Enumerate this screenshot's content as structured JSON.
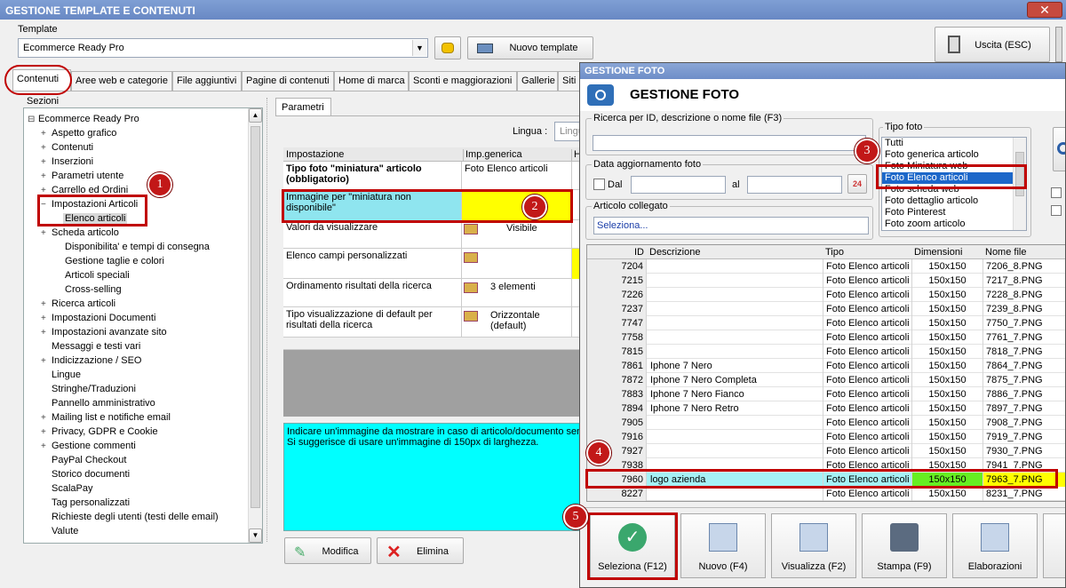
{
  "main_title": "GESTIONE TEMPLATE E CONTENUTI",
  "close_label": "✕",
  "template": {
    "label": "Template",
    "value": "Ecommerce Ready Pro",
    "new_label": "Nuovo template",
    "exit_label": "Uscita (ESC)"
  },
  "tabs": [
    "Contenuti",
    "Aree web e categorie",
    "File aggiuntivi",
    "Pagine di contenuti",
    "Home di marca",
    "Sconti e maggiorazioni",
    "Gallerie",
    "Siti"
  ],
  "sections_label": "Sezioni",
  "tree": [
    {
      "t": "Ecommerce Ready Pro",
      "pm": "⊟"
    },
    {
      "t": "Aspetto grafico",
      "pm": "+"
    },
    {
      "t": "Contenuti",
      "pm": "+"
    },
    {
      "t": "Inserzioni",
      "pm": "+"
    },
    {
      "t": "Parametri utente",
      "pm": "+"
    },
    {
      "t": "Carrello ed Ordini",
      "pm": "+"
    },
    {
      "t": "Impostazioni Articoli",
      "pm": "−"
    },
    {
      "t": "Elenco articoli",
      "pm": ""
    },
    {
      "t": "Scheda articolo",
      "pm": "+"
    },
    {
      "t": "Disponibilita' e tempi di consegna",
      "pm": ""
    },
    {
      "t": "Gestione taglie e colori",
      "pm": ""
    },
    {
      "t": "Articoli speciali",
      "pm": ""
    },
    {
      "t": "Cross-selling",
      "pm": ""
    },
    {
      "t": "Ricerca articoli",
      "pm": "+"
    },
    {
      "t": "Impostazioni Documenti",
      "pm": "+"
    },
    {
      "t": "Impostazioni avanzate sito",
      "pm": "+"
    },
    {
      "t": "Messaggi e testi vari",
      "pm": ""
    },
    {
      "t": "Indicizzazione / SEO",
      "pm": "+"
    },
    {
      "t": "Lingue",
      "pm": ""
    },
    {
      "t": "Stringhe/Traduzioni",
      "pm": ""
    },
    {
      "t": "Pannello amministrativo",
      "pm": ""
    },
    {
      "t": "Mailing list e notifiche email",
      "pm": "+"
    },
    {
      "t": "Privacy, GDPR e Cookie",
      "pm": "+"
    },
    {
      "t": "Gestione commenti",
      "pm": "+"
    },
    {
      "t": "PayPal Checkout",
      "pm": ""
    },
    {
      "t": "Storico documenti",
      "pm": ""
    },
    {
      "t": "ScalaPay",
      "pm": ""
    },
    {
      "t": "Tag personalizzati",
      "pm": ""
    },
    {
      "t": "Richieste degli utenti (testi delle email)",
      "pm": ""
    },
    {
      "t": "Valute",
      "pm": ""
    }
  ],
  "params": {
    "tab": "Parametri",
    "lingua_label": "Lingua :",
    "lingua_value": "Lingu",
    "col_setting": "Impostazione",
    "col_generic": "Imp.generica",
    "col_h": "H",
    "rows": [
      {
        "s": "Tipo foto \"miniatura\" articolo (obbligatorio)",
        "v": ""
      },
      {
        "s": "Immagine per \"miniatura non disponibile\"",
        "v": ""
      },
      {
        "s": "Valori da visualizzare",
        "v": "Visibile"
      },
      {
        "s": "Elenco campi personalizzati",
        "v": ""
      },
      {
        "s": "Ordinamento risultati della ricerca",
        "v": "3 elementi"
      },
      {
        "s": "Tipo visualizzazione di default per risultati della ricerca",
        "v": "Orizzontale (default)"
      }
    ],
    "row0_value": "Foto Elenco articoli",
    "description": "Indicare un'immagine da mostrare in caso di articolo/documento senza\nSi suggerisce di usare un'immagine di 150px di larghezza.",
    "modify": "Modifica",
    "delete": "Elimina"
  },
  "foto": {
    "title": "GESTIONE FOTO",
    "header": "GESTIONE FOTO",
    "search_label": "Ricerca per ID, descrizione o nome file (F3)",
    "date_label": "Data aggiornamento foto",
    "dal": "Dal",
    "al": "al",
    "articolo_label": "Articolo collegato",
    "articolo_value": "Seleziona...",
    "tipo_label": "Tipo foto",
    "tipi": [
      "Tutti",
      "Foto generica articolo",
      "Foto Miniatura web",
      "Foto Elenco articoli",
      "Foto scheda web",
      "Foto dettaglio articolo",
      "Foto Pinterest",
      "Foto zoom articolo"
    ],
    "cols": [
      "ID",
      "Descrizione",
      "Tipo",
      "Dimensioni",
      "Nome file"
    ],
    "rows": [
      [
        "7204",
        "",
        "Foto Elenco articoli",
        "150x150",
        "7206_8.PNG"
      ],
      [
        "7215",
        "",
        "Foto Elenco articoli",
        "150x150",
        "7217_8.PNG"
      ],
      [
        "7226",
        "",
        "Foto Elenco articoli",
        "150x150",
        "7228_8.PNG"
      ],
      [
        "7237",
        "",
        "Foto Elenco articoli",
        "150x150",
        "7239_8.PNG"
      ],
      [
        "7747",
        "",
        "Foto Elenco articoli",
        "150x150",
        "7750_7.PNG"
      ],
      [
        "7758",
        "",
        "Foto Elenco articoli",
        "150x150",
        "7761_7.PNG"
      ],
      [
        "7815",
        "",
        "Foto Elenco articoli",
        "150x150",
        "7818_7.PNG"
      ],
      [
        "7861",
        "Iphone 7 Nero",
        "Foto Elenco articoli",
        "150x150",
        "7864_7.PNG"
      ],
      [
        "7872",
        "Iphone 7 Nero Completa",
        "Foto Elenco articoli",
        "150x150",
        "7875_7.PNG"
      ],
      [
        "7883",
        "Iphone 7 Nero Fianco",
        "Foto Elenco articoli",
        "150x150",
        "7886_7.PNG"
      ],
      [
        "7894",
        "Iphone 7 Nero Retro",
        "Foto Elenco articoli",
        "150x150",
        "7897_7.PNG"
      ],
      [
        "7905",
        "",
        "Foto Elenco articoli",
        "150x150",
        "7908_7.PNG"
      ],
      [
        "7916",
        "",
        "Foto Elenco articoli",
        "150x150",
        "7919_7.PNG"
      ],
      [
        "7927",
        "",
        "Foto Elenco articoli",
        "150x150",
        "7930_7.PNG"
      ],
      [
        "7938",
        "",
        "Foto Elenco articoli",
        "150x150",
        "7941_7.PNG"
      ],
      [
        "7960",
        "logo azienda",
        "Foto Elenco articoli",
        "150x150",
        "7963_7.PNG"
      ],
      [
        "8227",
        "",
        "Foto Elenco articoli",
        "150x150",
        "8231_7.PNG"
      ]
    ],
    "buttons": [
      "Seleziona (F12)",
      "Nuovo (F4)",
      "Visualizza (F2)",
      "Stampa (F9)",
      "Elaborazioni",
      "Usc"
    ]
  },
  "badges": [
    "1",
    "2",
    "3",
    "4",
    "5"
  ]
}
